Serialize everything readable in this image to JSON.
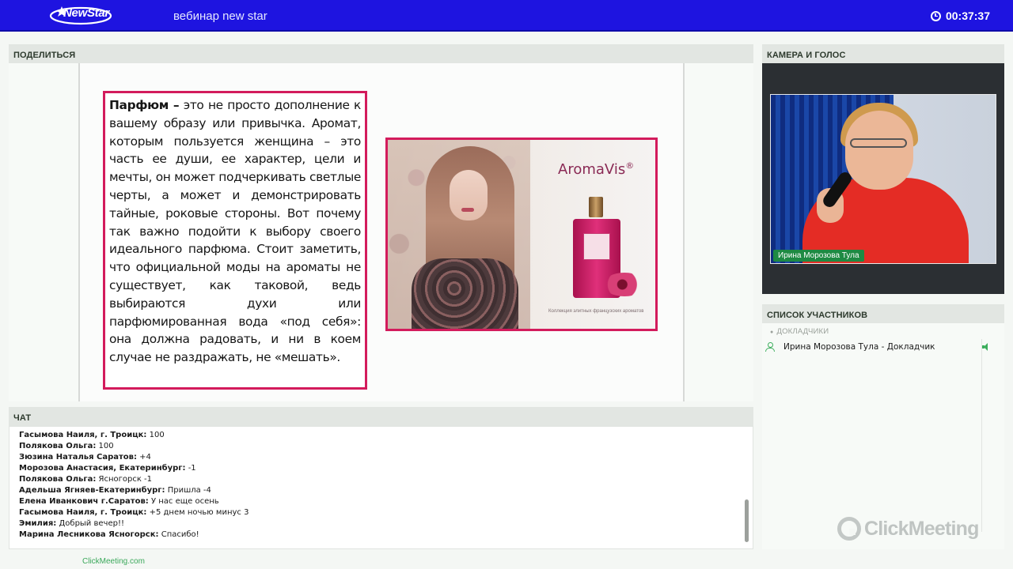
{
  "topbar": {
    "logo_text": "NewStar",
    "title": "вебинар new star",
    "timer": "00:37:37"
  },
  "share_panel": {
    "title": "ПОДЕЛИТЬСЯ",
    "slide": {
      "heading": "Парфюм –",
      "text": "это не просто дополнение к вашему образу или привычка. Аромат, которым пользуется женщина – это часть ее души, ее характер, цели и мечты, он может подчеркивать светлые черты, а может и демонстрировать тайные, роковые стороны. Вот почему так важно подойти к выбору своего идеального парфюма. Стоит заметить, что официальной моды на ароматы не существует, как таковой, ведь выбираются духи или парфюмированная вода «под себя»: она должна радовать, и ни в коем случае не раздражать, не «мешать».",
      "brand": "AromaVis",
      "brand_mark": "®",
      "image_caption": "Коллекция элитных французских ароматов"
    }
  },
  "chat_panel": {
    "title": "ЧАТ",
    "messages": [
      {
        "nick": "Гасымова Наиля, г. Троицк:",
        "text": "100"
      },
      {
        "nick": "Полякова Ольга:",
        "text": "100"
      },
      {
        "nick": "Зюзина Наталья Саратов:",
        "text": "+4"
      },
      {
        "nick": "Морозова Анастасия, Екатеринбург:",
        "text": "-1"
      },
      {
        "nick": "Полякова Ольга:",
        "text": "Ясногорск -1"
      },
      {
        "nick": "Адельша Ягняев-Екатеринбург:",
        "text": "Пришла -4"
      },
      {
        "nick": "Елена Иванкович г.Саратов:",
        "text": "У нас еще осень"
      },
      {
        "nick": "Гасымова Наиля, г. Троицк:",
        "text": "+5 днем  ночью минус 3"
      },
      {
        "nick": "Эмилия:",
        "text": "Добрый вечер!!"
      },
      {
        "nick": "Марина Лесникова Ясногорск:",
        "text": "Спасибо!"
      }
    ]
  },
  "camera_panel": {
    "title": "КАМЕРА И ГОЛОС",
    "presenter_name": "Ирина Морозова Тула"
  },
  "participants_panel": {
    "title": "СПИСОК УЧАСТНИКОВ",
    "group_label": "ДОКЛАДЧИКИ",
    "participants": [
      {
        "name": "Ирина Морозова Тула - Докладчик"
      }
    ]
  },
  "watermark": "ClickMeeting",
  "footer": {
    "link": "ClickMeeting.com"
  },
  "colors": {
    "topbar": "#1e14e0",
    "accent_frame": "#d31b5c",
    "status_green": "#3cae5c"
  }
}
